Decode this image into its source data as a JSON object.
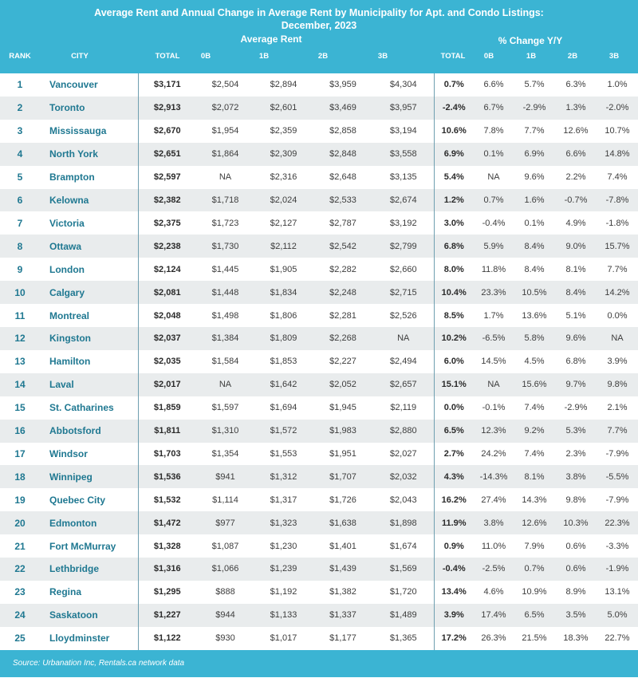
{
  "title_line1": "Average Rent and Annual Change in Average Rent by Municipality for Apt. and Condo Listings:",
  "title_line2": "December, 2023",
  "group_avg_rent": "Average Rent",
  "group_change": "% Change Y/Y",
  "columns": [
    "RANK",
    "CITY",
    "TOTAL",
    "0B",
    "1B",
    "2B",
    "3B",
    "TOTAL",
    "0B",
    "1B",
    "2B",
    "3B"
  ],
  "rows": [
    [
      "1",
      "Vancouver",
      "$3,171",
      "$2,504",
      "$2,894",
      "$3,959",
      "$4,304",
      "0.7%",
      "6.6%",
      "5.7%",
      "6.3%",
      "1.0%"
    ],
    [
      "2",
      "Toronto",
      "$2,913",
      "$2,072",
      "$2,601",
      "$3,469",
      "$3,957",
      "-2.4%",
      "6.7%",
      "-2.9%",
      "1.3%",
      "-2.0%"
    ],
    [
      "3",
      "Mississauga",
      "$2,670",
      "$1,954",
      "$2,359",
      "$2,858",
      "$3,194",
      "10.6%",
      "7.8%",
      "7.7%",
      "12.6%",
      "10.7%"
    ],
    [
      "4",
      "North York",
      "$2,651",
      "$1,864",
      "$2,309",
      "$2,848",
      "$3,558",
      "6.9%",
      "0.1%",
      "6.9%",
      "6.6%",
      "14.8%"
    ],
    [
      "5",
      "Brampton",
      "$2,597",
      "NA",
      "$2,316",
      "$2,648",
      "$3,135",
      "5.4%",
      "NA",
      "9.6%",
      "2.2%",
      "7.4%"
    ],
    [
      "6",
      "Kelowna",
      "$2,382",
      "$1,718",
      "$2,024",
      "$2,533",
      "$2,674",
      "1.2%",
      "0.7%",
      "1.6%",
      "-0.7%",
      "-7.8%"
    ],
    [
      "7",
      "Victoria",
      "$2,375",
      "$1,723",
      "$2,127",
      "$2,787",
      "$3,192",
      "3.0%",
      "-0.4%",
      "0.1%",
      "4.9%",
      "-1.8%"
    ],
    [
      "8",
      "Ottawa",
      "$2,238",
      "$1,730",
      "$2,112",
      "$2,542",
      "$2,799",
      "6.8%",
      "5.9%",
      "8.4%",
      "9.0%",
      "15.7%"
    ],
    [
      "9",
      "London",
      "$2,124",
      "$1,445",
      "$1,905",
      "$2,282",
      "$2,660",
      "8.0%",
      "11.8%",
      "8.4%",
      "8.1%",
      "7.7%"
    ],
    [
      "10",
      "Calgary",
      "$2,081",
      "$1,448",
      "$1,834",
      "$2,248",
      "$2,715",
      "10.4%",
      "23.3%",
      "10.5%",
      "8.4%",
      "14.2%"
    ],
    [
      "11",
      "Montreal",
      "$2,048",
      "$1,498",
      "$1,806",
      "$2,281",
      "$2,526",
      "8.5%",
      "1.7%",
      "13.6%",
      "5.1%",
      "0.0%"
    ],
    [
      "12",
      "Kingston",
      "$2,037",
      "$1,384",
      "$1,809",
      "$2,268",
      "NA",
      "10.2%",
      "-6.5%",
      "5.8%",
      "9.6%",
      "NA"
    ],
    [
      "13",
      "Hamilton",
      "$2,035",
      "$1,584",
      "$1,853",
      "$2,227",
      "$2,494",
      "6.0%",
      "14.5%",
      "4.5%",
      "6.8%",
      "3.9%"
    ],
    [
      "14",
      "Laval",
      "$2,017",
      "NA",
      "$1,642",
      "$2,052",
      "$2,657",
      "15.1%",
      "NA",
      "15.6%",
      "9.7%",
      "9.8%"
    ],
    [
      "15",
      "St. Catharines",
      "$1,859",
      "$1,597",
      "$1,694",
      "$1,945",
      "$2,119",
      "0.0%",
      "-0.1%",
      "7.4%",
      "-2.9%",
      "2.1%"
    ],
    [
      "16",
      "Abbotsford",
      "$1,811",
      "$1,310",
      "$1,572",
      "$1,983",
      "$2,880",
      "6.5%",
      "12.3%",
      "9.2%",
      "5.3%",
      "7.7%"
    ],
    [
      "17",
      "Windsor",
      "$1,703",
      "$1,354",
      "$1,553",
      "$1,951",
      "$2,027",
      "2.7%",
      "24.2%",
      "7.4%",
      "2.3%",
      "-7.9%"
    ],
    [
      "18",
      "Winnipeg",
      "$1,536",
      "$941",
      "$1,312",
      "$1,707",
      "$2,032",
      "4.3%",
      "-14.3%",
      "8.1%",
      "3.8%",
      "-5.5%"
    ],
    [
      "19",
      "Quebec City",
      "$1,532",
      "$1,114",
      "$1,317",
      "$1,726",
      "$2,043",
      "16.2%",
      "27.4%",
      "14.3%",
      "9.8%",
      "-7.9%"
    ],
    [
      "20",
      "Edmonton",
      "$1,472",
      "$977",
      "$1,323",
      "$1,638",
      "$1,898",
      "11.9%",
      "3.8%",
      "12.6%",
      "10.3%",
      "22.3%"
    ],
    [
      "21",
      "Fort McMurray",
      "$1,328",
      "$1,087",
      "$1,230",
      "$1,401",
      "$1,674",
      "0.9%",
      "11.0%",
      "7.9%",
      "0.6%",
      "-3.3%"
    ],
    [
      "22",
      "Lethbridge",
      "$1,316",
      "$1,066",
      "$1,239",
      "$1,439",
      "$1,569",
      "-0.4%",
      "-2.5%",
      "0.7%",
      "0.6%",
      "-1.9%"
    ],
    [
      "23",
      "Regina",
      "$1,295",
      "$888",
      "$1,192",
      "$1,382",
      "$1,720",
      "13.4%",
      "4.6%",
      "10.9%",
      "8.9%",
      "13.1%"
    ],
    [
      "24",
      "Saskatoon",
      "$1,227",
      "$944",
      "$1,133",
      "$1,337",
      "$1,489",
      "3.9%",
      "17.4%",
      "6.5%",
      "3.5%",
      "5.0%"
    ],
    [
      "25",
      "Lloydminster",
      "$1,122",
      "$930",
      "$1,017",
      "$1,177",
      "$1,365",
      "17.2%",
      "26.3%",
      "21.5%",
      "18.3%",
      "22.7%"
    ]
  ],
  "footer_source": "Source: Urbanation Inc, Rentals.ca network data",
  "colors": {
    "header_bg": "#3bb4d3",
    "city_text": "#1f7891",
    "alt_row": "#e9eced"
  }
}
